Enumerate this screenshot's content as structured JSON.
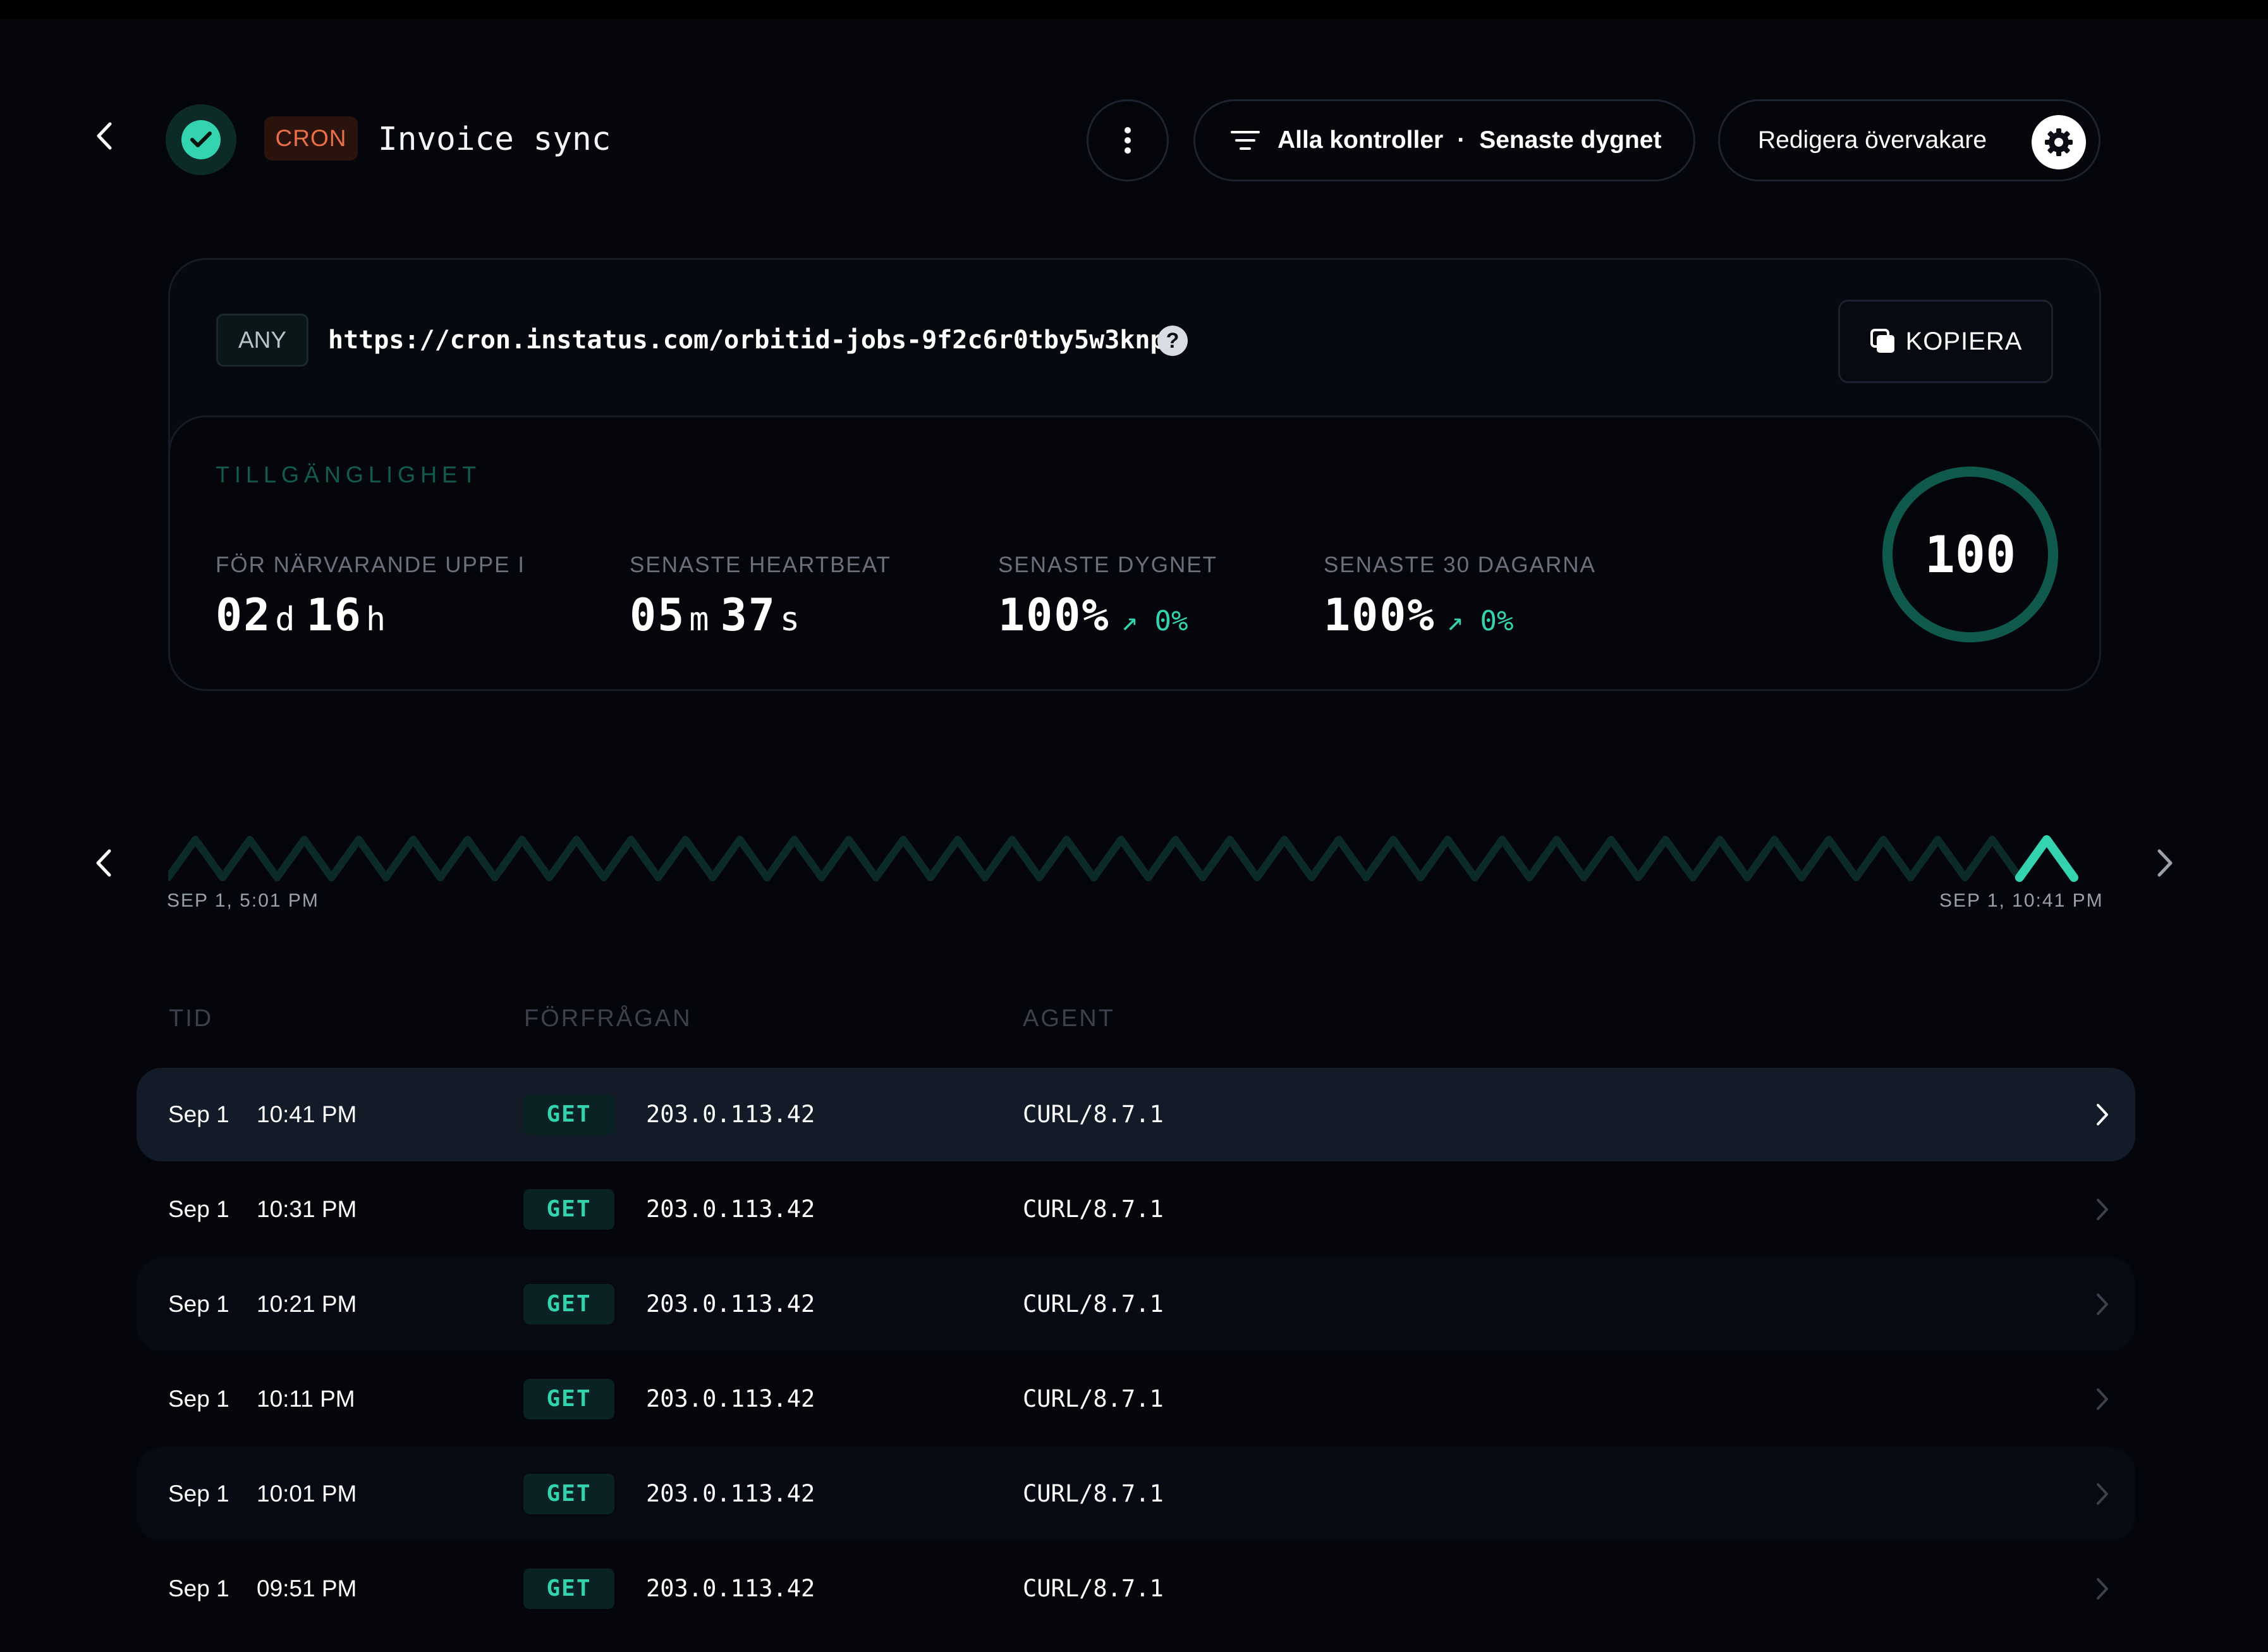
{
  "header": {
    "status_icon": "check-circle-icon",
    "type_badge": "CRON",
    "title": "Invoice sync",
    "filter_icon": "filter-icon",
    "filter_scope": "Alla kontroller",
    "filter_separator": "·",
    "filter_period": "Senaste dygnet",
    "edit_label": "Redigera övervakare",
    "edit_icon": "gear-icon"
  },
  "endpoint": {
    "method": "ANY",
    "url": "https://cron.instatus.com/orbitid-jobs-9f2c6r0tby5w3knp",
    "help_glyph": "?",
    "copy_label": "KOPIERA",
    "copy_icon": "copy-icon"
  },
  "availability": {
    "section_label": "TILLGÄNGLIGHET",
    "uptime_label": "FÖR NÄRVARANDE UPPE I",
    "uptime_days": "02",
    "uptime_days_unit": "d",
    "uptime_hours": "16",
    "uptime_hours_unit": "h",
    "heartbeat_label": "SENASTE HEARTBEAT",
    "heartbeat_minutes": "05",
    "heartbeat_minutes_unit": "m",
    "heartbeat_seconds": "37",
    "heartbeat_seconds_unit": "s",
    "day_label": "SENASTE DYGNET",
    "day_value": "100%",
    "day_delta": "↗ 0%",
    "month_label": "SENASTE 30 DAGARNA",
    "month_value": "100%",
    "month_delta": "↗ 0%",
    "score": "100",
    "score_fraction": 1.0
  },
  "timeline": {
    "start_label": "SEP 1, 5:01 PM",
    "end_label": "SEP 1, 10:41 PM",
    "heartbeat_count": 35
  },
  "colors": {
    "accent": "#34d3b0",
    "cron_badge": "#e86f47",
    "background": "#04060c"
  },
  "table": {
    "headers": [
      "TID",
      "FÖRFRÅGAN",
      "AGENT"
    ],
    "rows": [
      {
        "date": "Sep 1",
        "time": "10:41 PM",
        "method": "GET",
        "ip": "203.0.113.42",
        "agent": "CURL/8.7.1"
      },
      {
        "date": "Sep 1",
        "time": "10:31 PM",
        "method": "GET",
        "ip": "203.0.113.42",
        "agent": "CURL/8.7.1"
      },
      {
        "date": "Sep 1",
        "time": "10:21 PM",
        "method": "GET",
        "ip": "203.0.113.42",
        "agent": "CURL/8.7.1"
      },
      {
        "date": "Sep 1",
        "time": "10:11 PM",
        "method": "GET",
        "ip": "203.0.113.42",
        "agent": "CURL/8.7.1"
      },
      {
        "date": "Sep 1",
        "time": "10:01 PM",
        "method": "GET",
        "ip": "203.0.113.42",
        "agent": "CURL/8.7.1"
      },
      {
        "date": "Sep 1",
        "time": "09:51 PM",
        "method": "GET",
        "ip": "203.0.113.42",
        "agent": "CURL/8.7.1"
      }
    ]
  }
}
